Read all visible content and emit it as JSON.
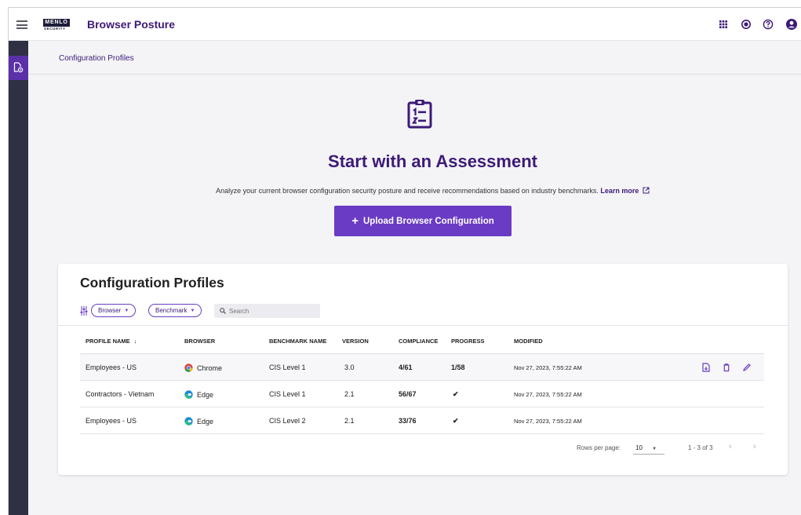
{
  "header": {
    "logo_text": "MENLO",
    "logo_sub": "SECURITY",
    "title": "Browser Posture",
    "icons": [
      "apps-grid-icon",
      "notification-icon",
      "help-icon",
      "account-icon"
    ]
  },
  "breadcrumb": {
    "current": "Configuration Profiles"
  },
  "hero": {
    "icon": "numbered-clipboard-icon",
    "title": "Start with an Assessment",
    "description": "Analyze your current browser configuration security posture and receive recommendations based on industry benchmarks.",
    "learn_more": "Learn more",
    "upload_label": "Upload Browser Configuration"
  },
  "card": {
    "title": "Configuration Profiles",
    "filters": {
      "browser": "Browser",
      "benchmark": "Benchmark"
    },
    "search": {
      "placeholder": "Search",
      "value": ""
    },
    "columns": [
      "PROFILE NAME",
      "BROWSER",
      "BENCHMARK NAME",
      "VERSION",
      "COMPLIANCE",
      "PROGRESS",
      "MODIFIED"
    ],
    "rows": [
      {
        "name": "Employees - US",
        "browser": "Chrome",
        "benchmark": "CIS Level 1",
        "version": "3.0",
        "compliance": "4/61",
        "progress": "1/58",
        "modified": "Nov 27, 2023, 7:55:22 AM"
      },
      {
        "name": "Contractors - Vietnam",
        "browser": "Edge",
        "benchmark": "CIS Level 1",
        "version": "2.1",
        "compliance": "56/67",
        "progress": "✔",
        "modified": "Nov 27, 2023, 7:55:22 AM"
      },
      {
        "name": "Employees - US",
        "browser": "Edge",
        "benchmark": "CIS Level 2",
        "version": "2.1",
        "compliance": "33/76",
        "progress": "✔",
        "modified": "Nov 27, 2023, 7:55:22 AM"
      }
    ],
    "pager": {
      "rows_per_page_label": "Rows per page:",
      "rows_per_page": "10",
      "range": "1 - 3 of 3"
    }
  },
  "colors": {
    "brand": "#3d1a78",
    "accent": "#6a3bc4",
    "sidebar": "#2f3044"
  }
}
